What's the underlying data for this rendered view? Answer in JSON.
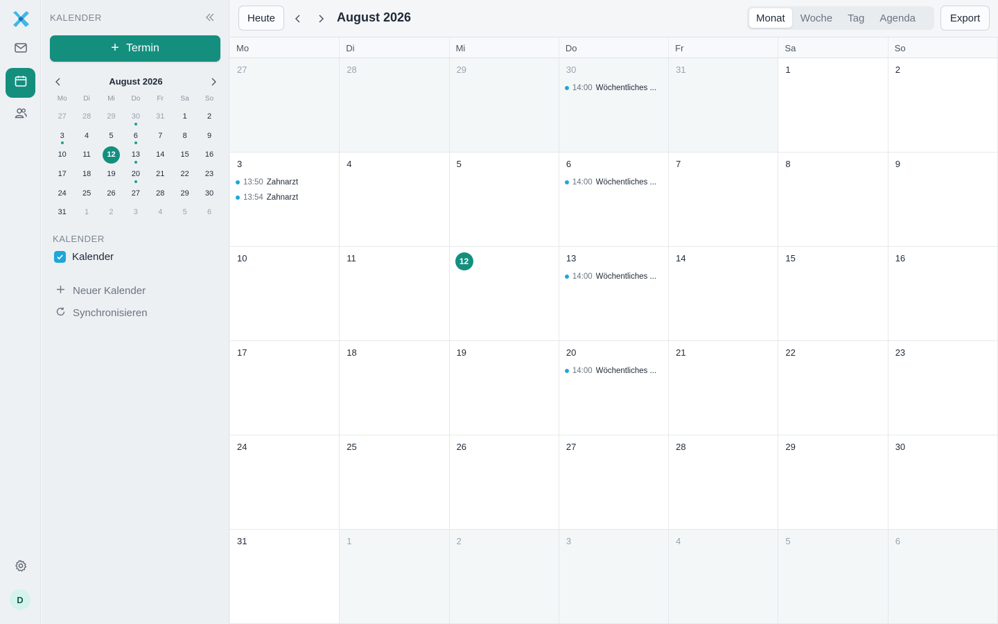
{
  "colors": {
    "accent": "#148f7e",
    "event": "#1fa6d8"
  },
  "rail": {
    "icons": [
      "logo-icon",
      "mail-icon",
      "calendar-icon",
      "contacts-icon",
      "gear-icon"
    ],
    "avatar_initial": "D"
  },
  "sidebar": {
    "title": "KALENDER",
    "new_button_label": "Termin",
    "mini": {
      "title": "August 2026",
      "weekdays": [
        "Mo",
        "Di",
        "Mi",
        "Do",
        "Fr",
        "Sa",
        "So"
      ],
      "days": [
        {
          "d": "27",
          "o": true
        },
        {
          "d": "28",
          "o": true
        },
        {
          "d": "29",
          "o": true
        },
        {
          "d": "30",
          "o": true,
          "dot": true
        },
        {
          "d": "31",
          "o": true
        },
        {
          "d": "1"
        },
        {
          "d": "2"
        },
        {
          "d": "3",
          "dot": true
        },
        {
          "d": "4"
        },
        {
          "d": "5"
        },
        {
          "d": "6",
          "dot": true
        },
        {
          "d": "7"
        },
        {
          "d": "8"
        },
        {
          "d": "9"
        },
        {
          "d": "10"
        },
        {
          "d": "11"
        },
        {
          "d": "12",
          "today": true
        },
        {
          "d": "13",
          "dot": true
        },
        {
          "d": "14"
        },
        {
          "d": "15"
        },
        {
          "d": "16"
        },
        {
          "d": "17"
        },
        {
          "d": "18"
        },
        {
          "d": "19"
        },
        {
          "d": "20",
          "dot": true
        },
        {
          "d": "21"
        },
        {
          "d": "22"
        },
        {
          "d": "23"
        },
        {
          "d": "24"
        },
        {
          "d": "25"
        },
        {
          "d": "26"
        },
        {
          "d": "27"
        },
        {
          "d": "28"
        },
        {
          "d": "29"
        },
        {
          "d": "30"
        },
        {
          "d": "31"
        },
        {
          "d": "1",
          "o": true
        },
        {
          "d": "2",
          "o": true
        },
        {
          "d": "3",
          "o": true
        },
        {
          "d": "4",
          "o": true
        },
        {
          "d": "5",
          "o": true
        },
        {
          "d": "6",
          "o": true
        }
      ]
    },
    "calendars_title": "KALENDER",
    "calendar_item": "Kalender",
    "new_calendar": "Neuer Kalender",
    "sync": "Synchronisieren"
  },
  "toolbar": {
    "today_label": "Heute",
    "month_title": "August 2026",
    "views": [
      "Monat",
      "Woche",
      "Tag",
      "Agenda"
    ],
    "active_view": "Monat",
    "export_label": "Export"
  },
  "month": {
    "weekdays": [
      "Mo",
      "Di",
      "Mi",
      "Do",
      "Fr",
      "Sa",
      "So"
    ],
    "cells": [
      {
        "d": "27",
        "o": true
      },
      {
        "d": "28",
        "o": true
      },
      {
        "d": "29",
        "o": true
      },
      {
        "d": "30",
        "o": true,
        "events": [
          {
            "time": "14:00",
            "title": "Wöchentliches ..."
          }
        ]
      },
      {
        "d": "31",
        "o": true
      },
      {
        "d": "1"
      },
      {
        "d": "2"
      },
      {
        "d": "3",
        "events": [
          {
            "time": "13:50",
            "title": "Zahnarzt"
          },
          {
            "time": "13:54",
            "title": "Zahnarzt"
          }
        ]
      },
      {
        "d": "4"
      },
      {
        "d": "5"
      },
      {
        "d": "6",
        "events": [
          {
            "time": "14:00",
            "title": "Wöchentliches ..."
          }
        ]
      },
      {
        "d": "7"
      },
      {
        "d": "8"
      },
      {
        "d": "9"
      },
      {
        "d": "10"
      },
      {
        "d": "11"
      },
      {
        "d": "12",
        "today": true
      },
      {
        "d": "13",
        "events": [
          {
            "time": "14:00",
            "title": "Wöchentliches ..."
          }
        ]
      },
      {
        "d": "14"
      },
      {
        "d": "15"
      },
      {
        "d": "16"
      },
      {
        "d": "17"
      },
      {
        "d": "18"
      },
      {
        "d": "19"
      },
      {
        "d": "20",
        "events": [
          {
            "time": "14:00",
            "title": "Wöchentliches ..."
          }
        ]
      },
      {
        "d": "21"
      },
      {
        "d": "22"
      },
      {
        "d": "23"
      },
      {
        "d": "24"
      },
      {
        "d": "25"
      },
      {
        "d": "26"
      },
      {
        "d": "27"
      },
      {
        "d": "28"
      },
      {
        "d": "29"
      },
      {
        "d": "30"
      },
      {
        "d": "31"
      },
      {
        "d": "1",
        "o": true
      },
      {
        "d": "2",
        "o": true
      },
      {
        "d": "3",
        "o": true
      },
      {
        "d": "4",
        "o": true
      },
      {
        "d": "5",
        "o": true
      },
      {
        "d": "6",
        "o": true
      }
    ]
  }
}
